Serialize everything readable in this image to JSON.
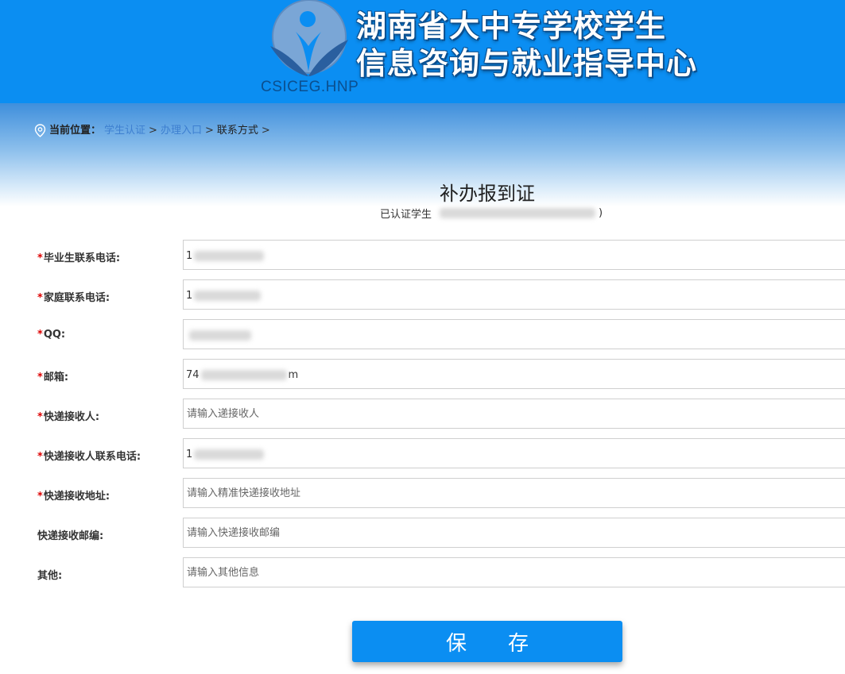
{
  "header": {
    "title_line1": "湖南省大中专学校学生",
    "title_line2": "信息咨询与就业指导中心",
    "logo_caption": "CSICEG.HNP"
  },
  "breadcrumb": {
    "label": "当前位置：",
    "items": [
      "学生认证",
      "办理入口",
      "联系方式"
    ],
    "separator": ">"
  },
  "page": {
    "title": "补办报到证",
    "subtitle_prefix": "已认证学生",
    "subtitle_suffix": ")"
  },
  "form": {
    "fields": [
      {
        "label": "毕业生联系电话:",
        "required": true,
        "value": "1",
        "placeholder": ""
      },
      {
        "label": "家庭联系电话:",
        "required": true,
        "value": "1",
        "placeholder": ""
      },
      {
        "label": "QQ:",
        "required": true,
        "value": "",
        "placeholder": ""
      },
      {
        "label": "邮箱:",
        "required": true,
        "value_visible_start": "74",
        "value_visible_end": "m",
        "placeholder": ""
      },
      {
        "label": "快递接收人:",
        "required": true,
        "value": "",
        "placeholder": "请输入递接收人"
      },
      {
        "label": "快递接收人联系电话:",
        "required": true,
        "value": "1",
        "placeholder": ""
      },
      {
        "label": "快递接收地址:",
        "required": true,
        "value": "",
        "placeholder": "请输入精准快递接收地址"
      },
      {
        "label": "快递接收邮编:",
        "required": false,
        "value": "",
        "placeholder": "请输入快递接收邮编"
      },
      {
        "label": "其他:",
        "required": false,
        "value": "",
        "placeholder": "请输入其他信息"
      }
    ],
    "required_mark": "*",
    "save_label": "保存"
  },
  "colors": {
    "header_blue": "#0b8ef2",
    "link_blue": "#3d7fd0",
    "required_red": "#dd0000"
  }
}
